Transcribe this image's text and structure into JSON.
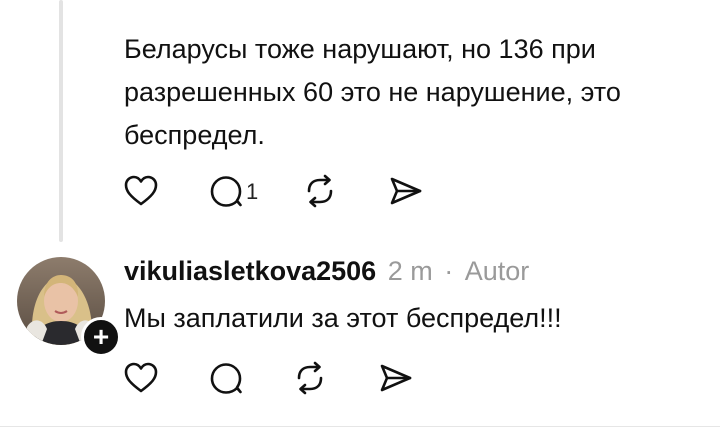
{
  "parent_post": {
    "text": "Беларусы тоже нарушают, но 136 при разрешенных 60 это не нарушение, это беспредел.",
    "actions": {
      "reply_count": "1"
    }
  },
  "reply": {
    "username": "vikuliasletkova2506",
    "time": "2 m",
    "separator": "·",
    "role": "Autor",
    "text": "Мы заплатили за этот беспредел!!!",
    "follow_symbol": "+"
  },
  "icons": [
    "heart-icon",
    "comment-icon",
    "repost-icon",
    "share-icon",
    "plus-icon"
  ],
  "colors": {
    "text": "#111111",
    "meta": "#9a9a9a",
    "thread_line": "#e3e3e3",
    "icon": "#111111"
  }
}
